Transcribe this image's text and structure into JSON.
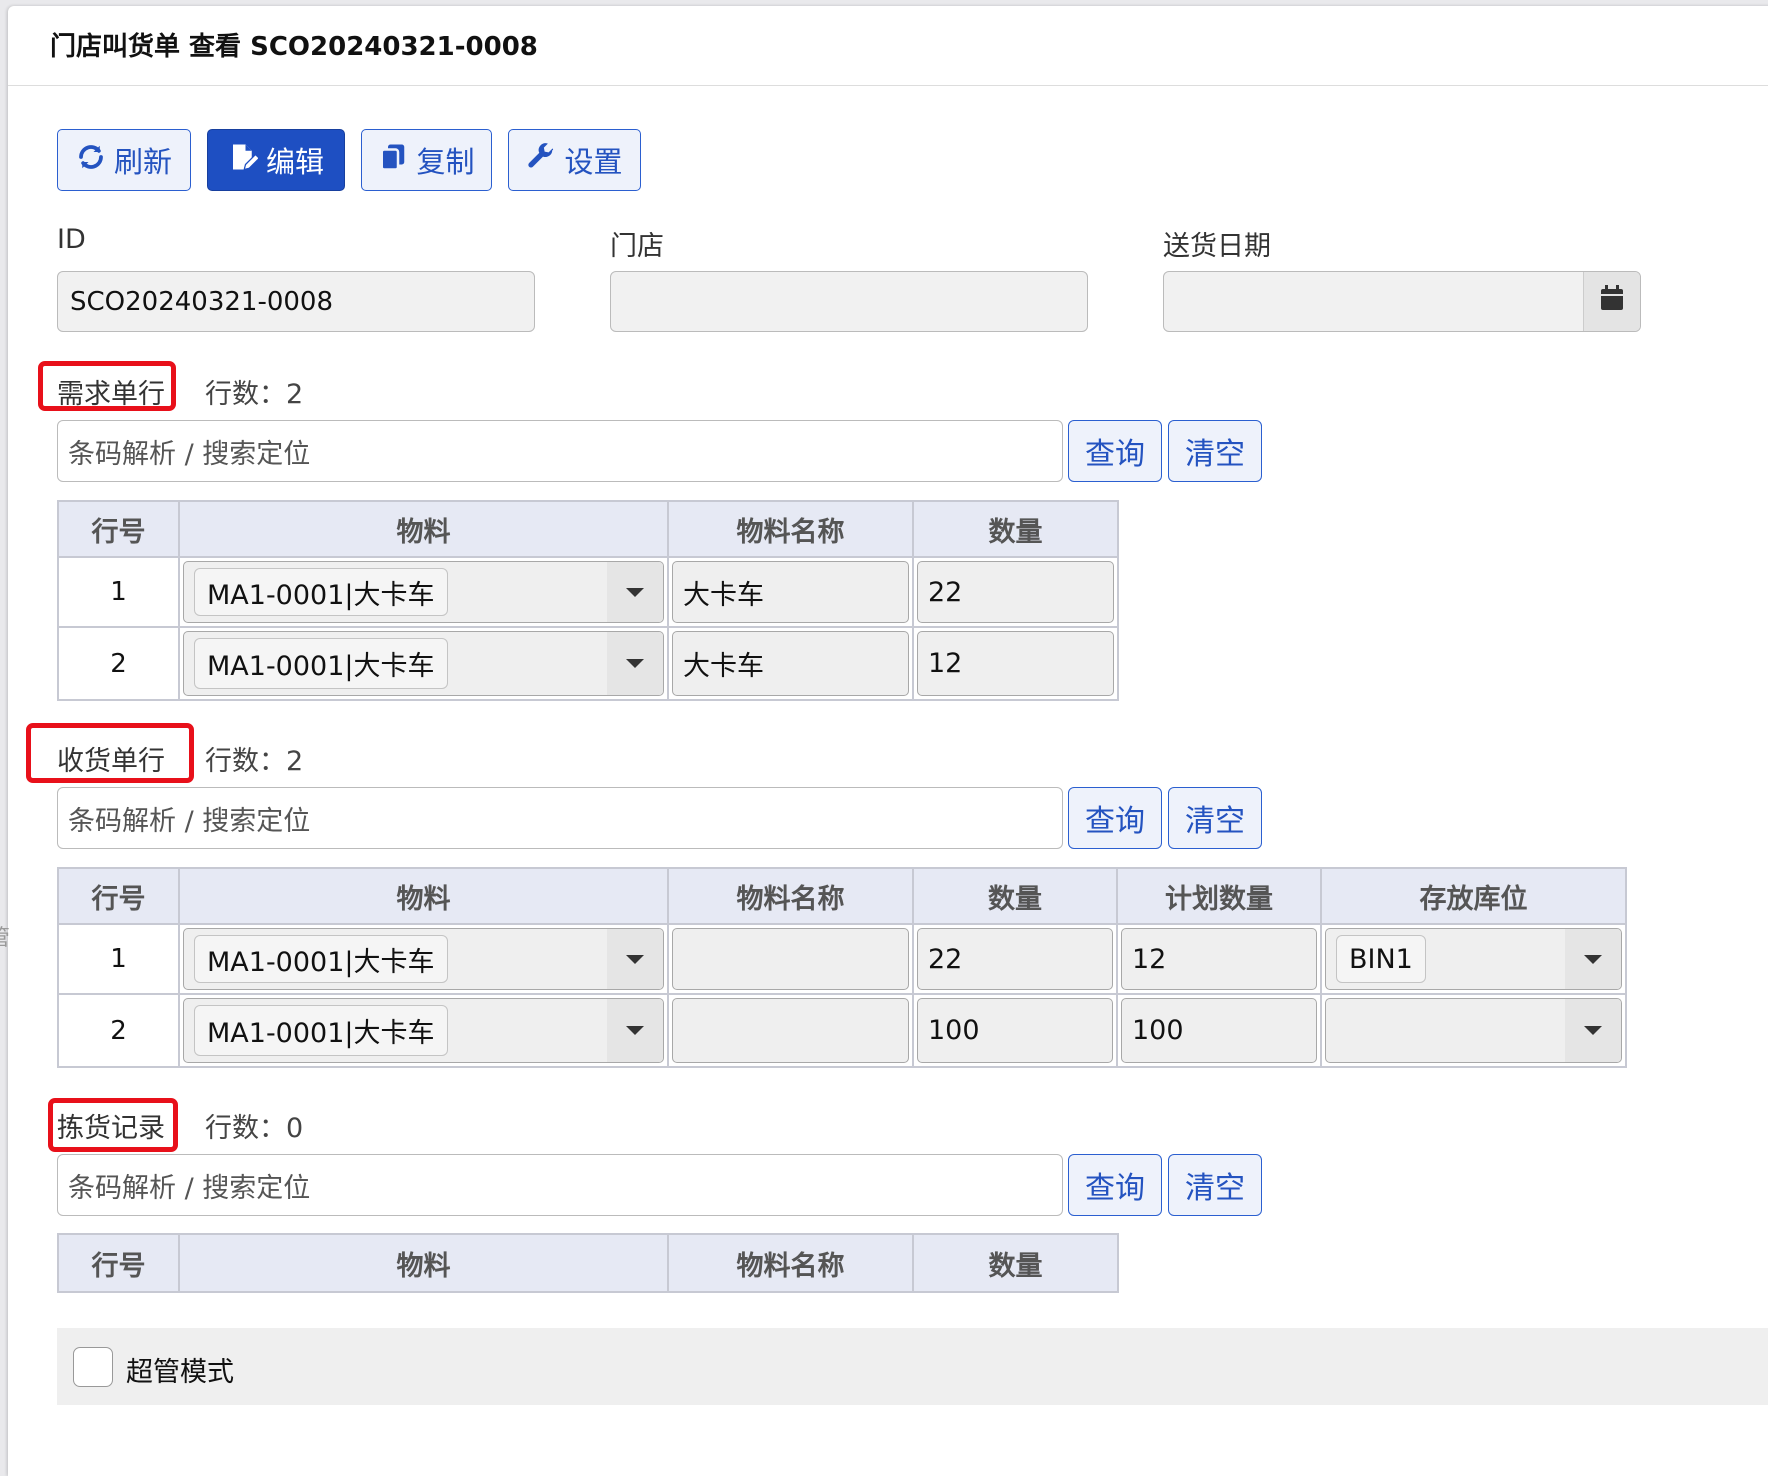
{
  "window": {
    "title": "门店叫货单 查看 SCO20240321-0008"
  },
  "toolbar": {
    "refresh_label": "刷新",
    "edit_label": "编辑",
    "copy_label": "复制",
    "settings_label": "设置"
  },
  "form": {
    "id": {
      "label": "ID",
      "value": "SCO20240321-0008"
    },
    "store": {
      "label": "门店",
      "value": ""
    },
    "delivery_date": {
      "label": "送货日期",
      "value": ""
    }
  },
  "sections": {
    "demand": {
      "title": "需求单行",
      "count_text": "行数：2",
      "search_placeholder": "条码解析 / 搜索定位",
      "query_label": "查询",
      "clear_label": "清空",
      "headers": [
        "行号",
        "物料",
        "物料名称",
        "数量"
      ],
      "rows": [
        {
          "no": "1",
          "material": "MA1-0001|大卡车",
          "name": "大卡车",
          "qty": "22"
        },
        {
          "no": "2",
          "material": "MA1-0001|大卡车",
          "name": "大卡车",
          "qty": "12"
        }
      ]
    },
    "receipt": {
      "title": "收货单行",
      "count_text": "行数：2",
      "search_placeholder": "条码解析 / 搜索定位",
      "query_label": "查询",
      "clear_label": "清空",
      "headers": [
        "行号",
        "物料",
        "物料名称",
        "数量",
        "计划数量",
        "存放库位"
      ],
      "rows": [
        {
          "no": "1",
          "material": "MA1-0001|大卡车",
          "name": "",
          "qty": "22",
          "plan_qty": "12",
          "bin": "BIN1"
        },
        {
          "no": "2",
          "material": "MA1-0001|大卡车",
          "name": "",
          "qty": "100",
          "plan_qty": "100",
          "bin": ""
        }
      ]
    },
    "picking": {
      "title": "拣货记录",
      "count_text": "行数：0",
      "search_placeholder": "条码解析 / 搜索定位",
      "query_label": "查询",
      "clear_label": "清空",
      "headers": [
        "行号",
        "物料",
        "物料名称",
        "数量"
      ],
      "rows": []
    }
  },
  "super_mode": {
    "label": "超管模式",
    "checked": false
  },
  "colors": {
    "accent": "#1e4fc2",
    "highlight_box": "#e8101a",
    "header_bg": "#e6e9f4"
  },
  "icons": [
    "refresh-icon",
    "edit-icon",
    "copy-icon",
    "wrench-icon",
    "calendar-icon",
    "chevron-down-icon"
  ]
}
